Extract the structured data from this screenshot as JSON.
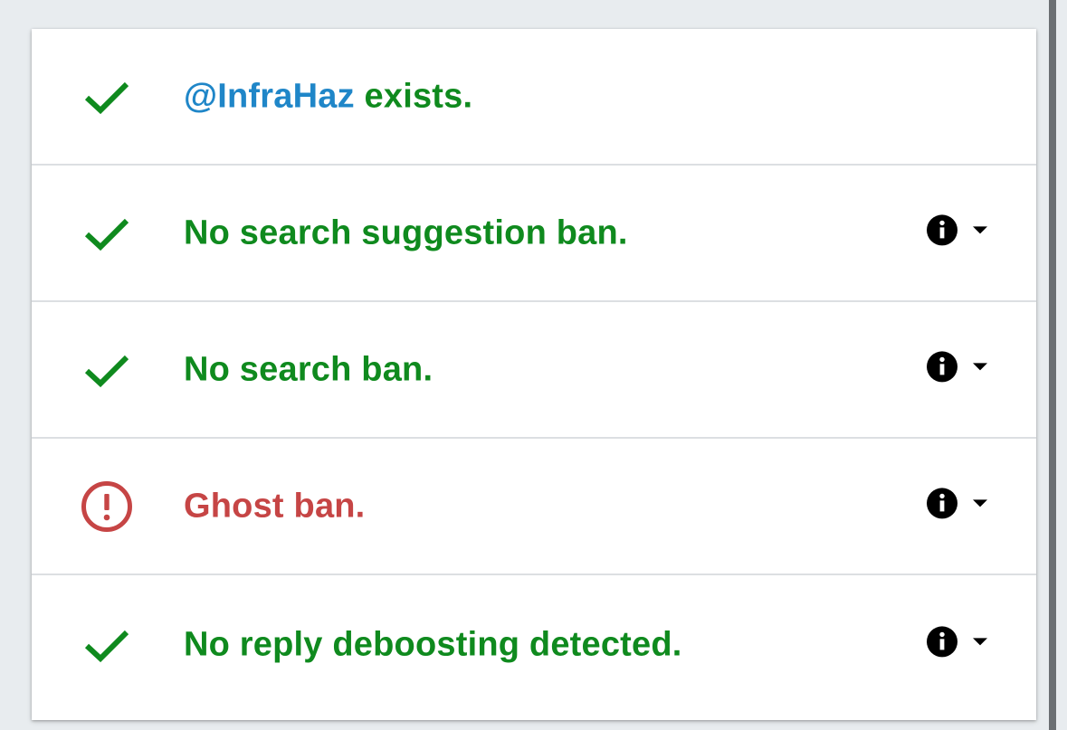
{
  "colors": {
    "ok": "#0f8a1e",
    "error": "#c64545",
    "link": "#1f86c8",
    "icon": "#000000",
    "background": "#e8ecef",
    "card": "#ffffff",
    "divider": "#dcdfe2"
  },
  "results": [
    {
      "status": "ok",
      "icon": "check-icon",
      "handle": "@InfraHaz",
      "text": " exists."
    },
    {
      "status": "ok",
      "icon": "check-icon",
      "text": "No search suggestion ban.",
      "has_details": true
    },
    {
      "status": "ok",
      "icon": "check-icon",
      "text": "No search ban.",
      "has_details": true
    },
    {
      "status": "error",
      "icon": "alert-circle-icon",
      "text": "Ghost ban.",
      "has_details": true
    },
    {
      "status": "ok",
      "icon": "check-icon",
      "text": "No reply deboosting detected.",
      "has_details": true
    }
  ],
  "actions": {
    "info_icon": "info-icon",
    "expand_icon": "caret-down-icon"
  }
}
